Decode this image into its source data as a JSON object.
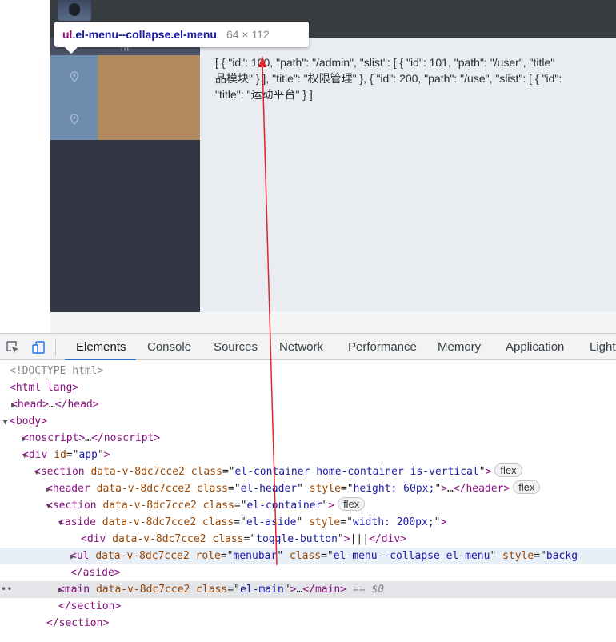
{
  "tooltip": {
    "tag": "ul",
    "classes": ".el-menu--collapse.el-menu",
    "size": "64 × 112"
  },
  "page": {
    "toggle_label": "|||",
    "main_text_lines": [
      "[ { \"id\": 100, \"path\": \"/admin\", \"slist\": [ { \"id\": 101, \"path\": \"/user\", \"title\"",
      "品模块\" } ], \"title\": \"权限管理\" }, { \"id\": 200, \"path\": \"/use\", \"slist\": [ { \"id\":",
      "\"title\": \"运动平台\" } ]"
    ],
    "menu_icons": [
      "location-pin-icon",
      "location-pin-icon"
    ],
    "colors": {
      "header": "#373d41",
      "aside": "#333744",
      "menu_collapse": "#6d8cae",
      "menu_block": "#b08a5e",
      "main": "#e9edf1",
      "arrow": "#e0242a"
    }
  },
  "devtools": {
    "tabs": [
      "Elements",
      "Console",
      "Sources",
      "Network",
      "Performance",
      "Memory",
      "Application",
      "Light"
    ],
    "active_tab": "Elements",
    "dom": {
      "doctype": "<!DOCTYPE html>",
      "html_open": "html lang",
      "head": "head",
      "body": "body",
      "noscript": "noscript",
      "app_div": {
        "tag": "div",
        "attr": "id",
        "value": "app"
      },
      "section1": {
        "tag": "section",
        "attr1": "data-v-8dc7cce2",
        "attr2": "class",
        "value2": "el-container home-container is-vertical",
        "badge": "flex"
      },
      "header": {
        "tag": "header",
        "attr1": "data-v-8dc7cce2",
        "attr2": "class",
        "value2": "el-header",
        "attr3": "style",
        "value3": "height: 60px;",
        "badge": "flex"
      },
      "section2": {
        "tag": "section",
        "attr1": "data-v-8dc7cce2",
        "attr2": "class",
        "value2": "el-container",
        "badge": "flex"
      },
      "aside": {
        "tag": "aside",
        "attr1": "data-v-8dc7cce2",
        "attr2": "class",
        "value2": "el-aside",
        "attr3": "style",
        "value3": "width: 200px;"
      },
      "toggle_div": {
        "tag": "div",
        "attr1": "data-v-8dc7cce2",
        "attr2": "class",
        "value2": "toggle-button",
        "text": "|||"
      },
      "ul": {
        "tag": "ul",
        "attr1": "data-v-8dc7cce2",
        "attr2": "role",
        "value2": "menubar",
        "attr3": "class",
        "value3": "el-menu--collapse el-menu",
        "attr4": "style",
        "value4": "backg"
      },
      "aside_close": "aside",
      "main": {
        "tag": "main",
        "attr1": "data-v-8dc7cce2",
        "attr2": "class",
        "value2": "el-main",
        "suffix": "== $0"
      },
      "section_close": "section",
      "section_close2": "section"
    }
  }
}
